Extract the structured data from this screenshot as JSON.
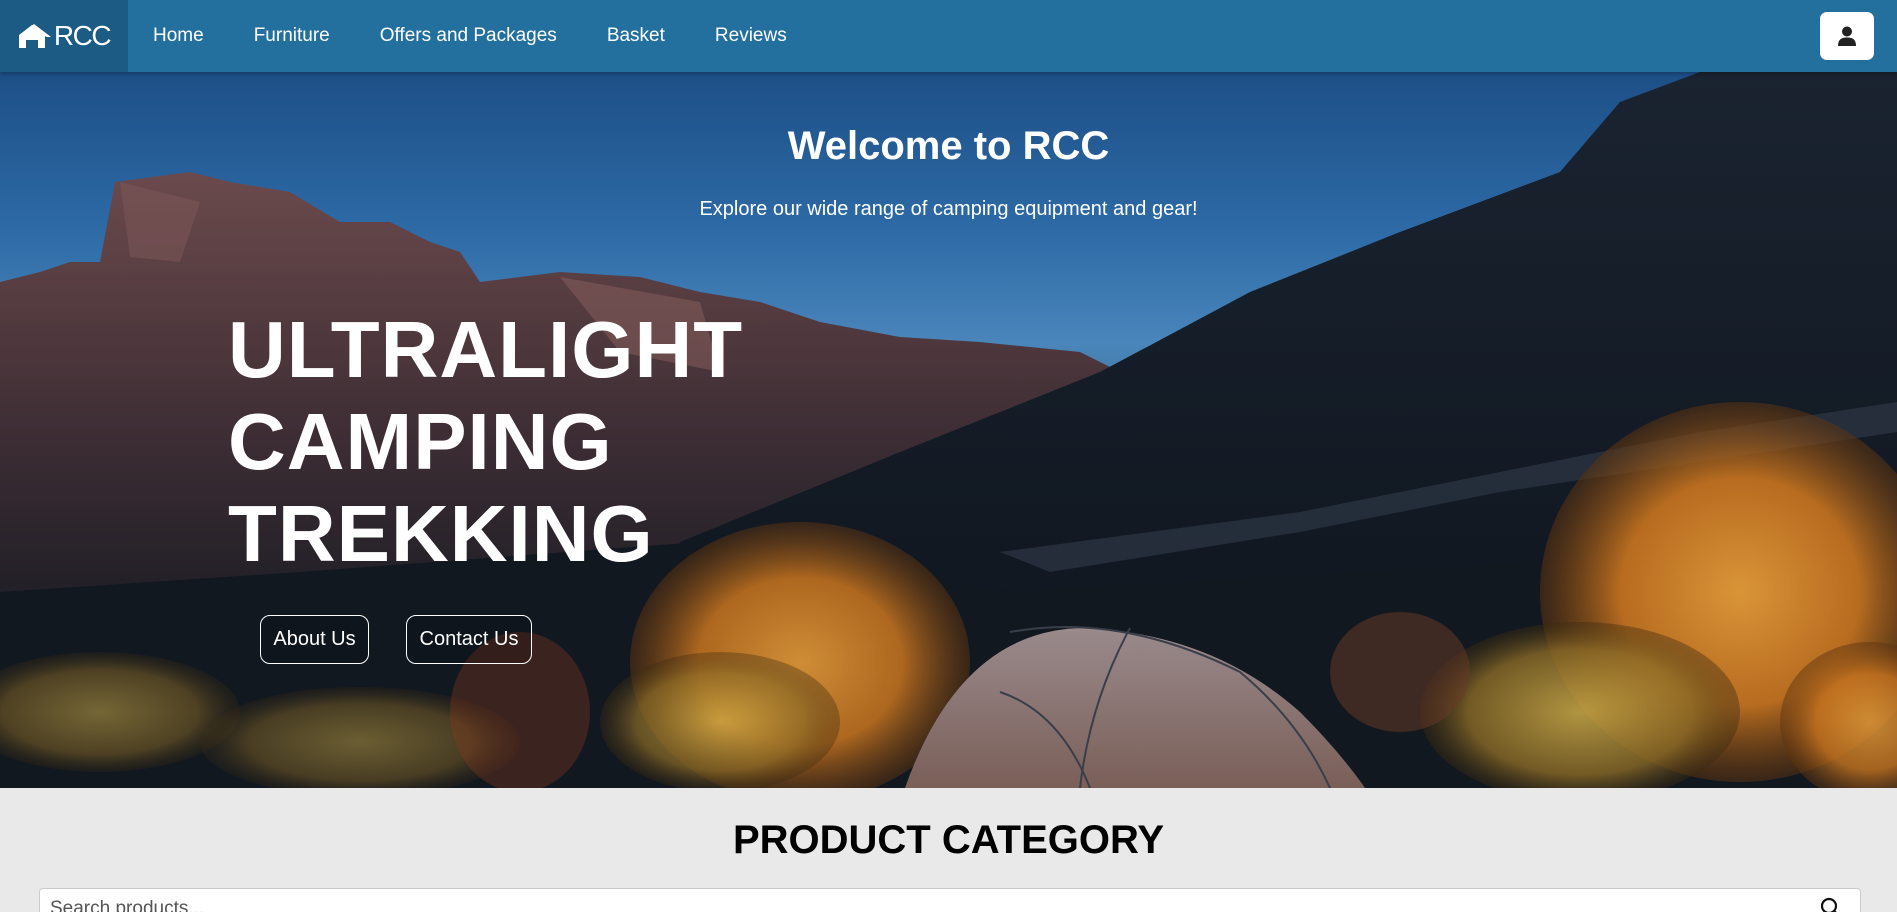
{
  "navbar": {
    "logo_text": "RCC",
    "links": [
      {
        "label": "Home"
      },
      {
        "label": "Furniture"
      },
      {
        "label": "Offers and Packages"
      },
      {
        "label": "Basket"
      },
      {
        "label": "Reviews"
      }
    ],
    "user_icon": "user-icon"
  },
  "hero": {
    "welcome": "Welcome to RCC",
    "subtitle": "Explore our wide range of camping equipment and gear!",
    "headline": [
      "ULTRALIGHT",
      "CAMPING",
      "TREKKING"
    ],
    "about_label": "About Us",
    "contact_label": "Contact Us"
  },
  "category": {
    "title": "PRODUCT CATEGORY",
    "search_placeholder": "Search products...",
    "search_icon": "search-icon"
  },
  "colors": {
    "navbar": "#23709f",
    "logo_bg": "#1c5c84",
    "page_bg": "#e9e9e9"
  }
}
